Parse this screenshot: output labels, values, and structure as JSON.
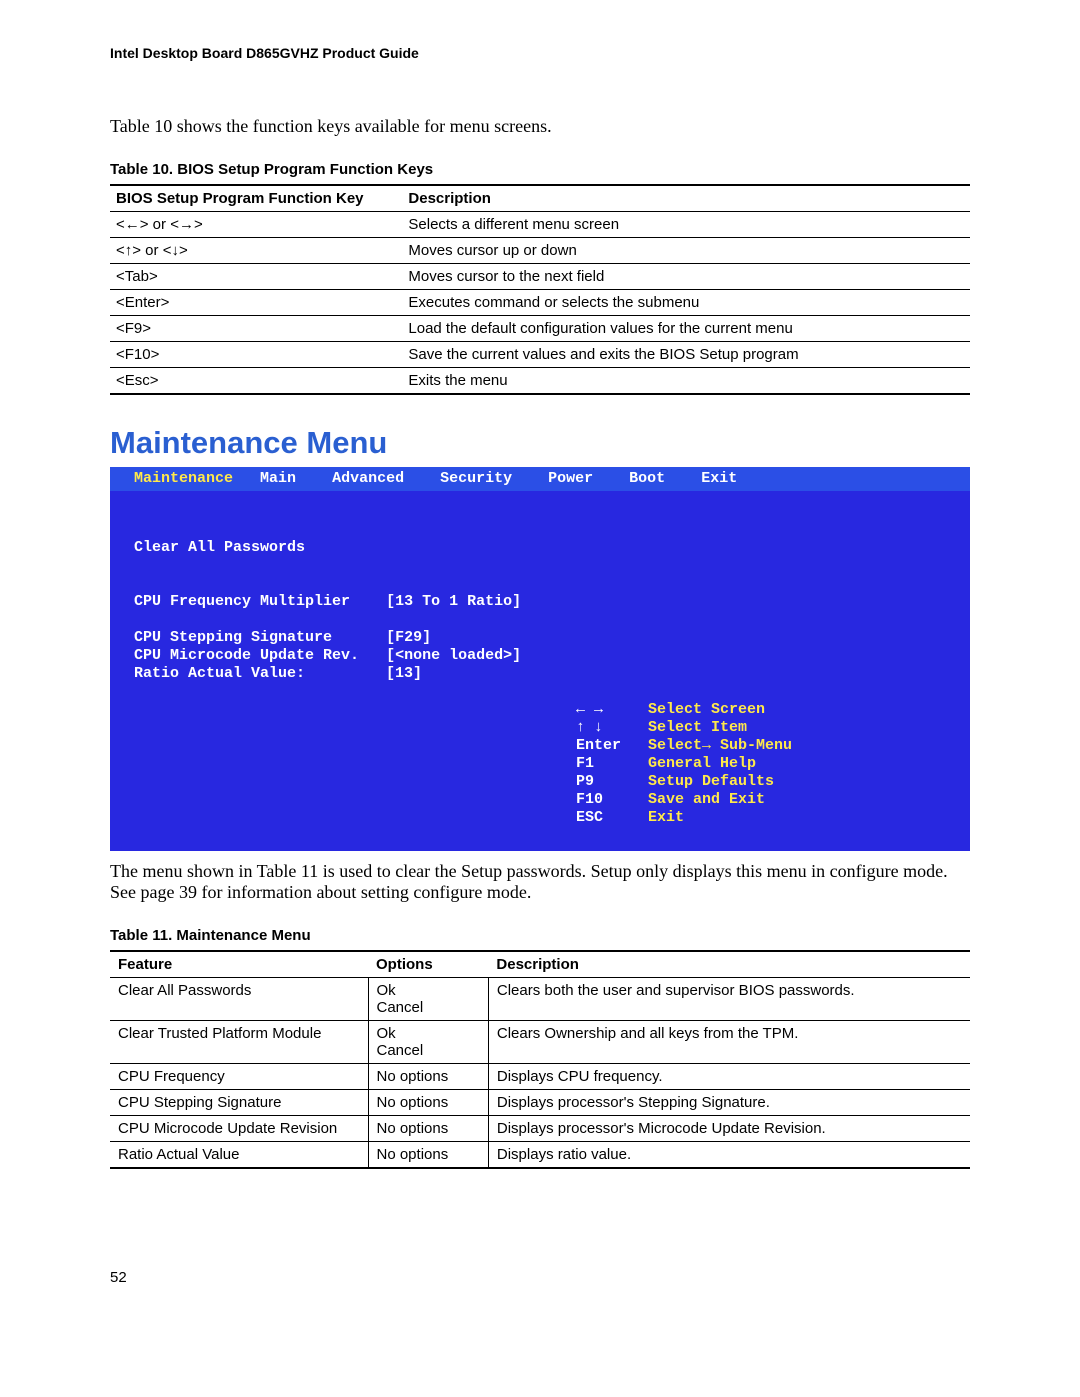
{
  "doc_header": "Intel Desktop Board D865GVHZ Product Guide",
  "intro_text": "Table 10 shows the function keys available for menu screens.",
  "table10": {
    "caption": "Table 10.   BIOS Setup Program Function Keys",
    "headers": {
      "col1": "BIOS Setup Program Function Key",
      "col2": "Description"
    },
    "rows": [
      {
        "k": "<←> or <→>",
        "d": "Selects a different menu screen"
      },
      {
        "k": "<↑> or <↓>",
        "d": "Moves cursor up or down"
      },
      {
        "k": "<Tab>",
        "d": "Moves cursor to the next field"
      },
      {
        "k": "<Enter>",
        "d": "Executes command or selects the submenu"
      },
      {
        "k": "<F9>",
        "d": "Load the default configuration values for the current menu"
      },
      {
        "k": "<F10>",
        "d": "Save the current values and exits the BIOS Setup program"
      },
      {
        "k": "<Esc>",
        "d": "Exits the menu"
      }
    ]
  },
  "section_title": "Maintenance Menu",
  "bios": {
    "menu": {
      "selected": "Maintenance",
      "items": [
        "Main",
        "Advanced",
        "Security",
        "Power",
        "Boot",
        "Exit"
      ]
    },
    "left": {
      "l1": "Clear All Passwords",
      "l2a": "CPU Frequency Multiplier",
      "l2b": "[13 To 1 Ratio]",
      "l3a": "CPU Stepping Signature",
      "l3b": "[F29]",
      "l4a": "CPU Microcode Update Rev.",
      "l4b": "[<none loaded>]",
      "l5a": "Ratio Actual Value:",
      "l5b": "[13]"
    },
    "help": [
      {
        "key": "← →",
        "label": "Select Screen"
      },
      {
        "key": "↑ ↓",
        "label": "Select Item"
      },
      {
        "key": "Enter",
        "label": "Select→ Sub-Menu"
      },
      {
        "key": "F1",
        "label": "General Help"
      },
      {
        "key": "P9",
        "label": "Setup Defaults"
      },
      {
        "key": "F10",
        "label": "Save and Exit"
      },
      {
        "key": "ESC",
        "label": "Exit"
      }
    ]
  },
  "after_bios": "The menu shown in Table 11 is used to clear the Setup passwords.  Setup only displays this menu in configure mode.  See page 39 for information about setting configure mode.",
  "table11": {
    "caption": "Table 11.   Maintenance Menu",
    "headers": {
      "c1": "Feature",
      "c2": "Options",
      "c3": "Description"
    },
    "rows": [
      {
        "f": "Clear All Passwords",
        "o1": "Ok",
        "o2": "Cancel",
        "d": "Clears both the user and supervisor BIOS passwords."
      },
      {
        "f": "Clear Trusted Platform Module",
        "o1": "Ok",
        "o2": "Cancel",
        "d": "Clears Ownership and all keys from the TPM."
      },
      {
        "f": "CPU Frequency",
        "o1": "No options",
        "o2": "",
        "d": "Displays CPU frequency."
      },
      {
        "f": "CPU Stepping Signature",
        "o1": "No options",
        "o2": "",
        "d": "Displays processor's Stepping Signature."
      },
      {
        "f": "CPU Microcode Update Revision",
        "o1": "No options",
        "o2": "",
        "d": "Displays processor's Microcode Update Revision."
      },
      {
        "f": "Ratio Actual Value",
        "o1": "No options",
        "o2": "",
        "d": "Displays ratio value."
      }
    ]
  },
  "page_number": "52"
}
